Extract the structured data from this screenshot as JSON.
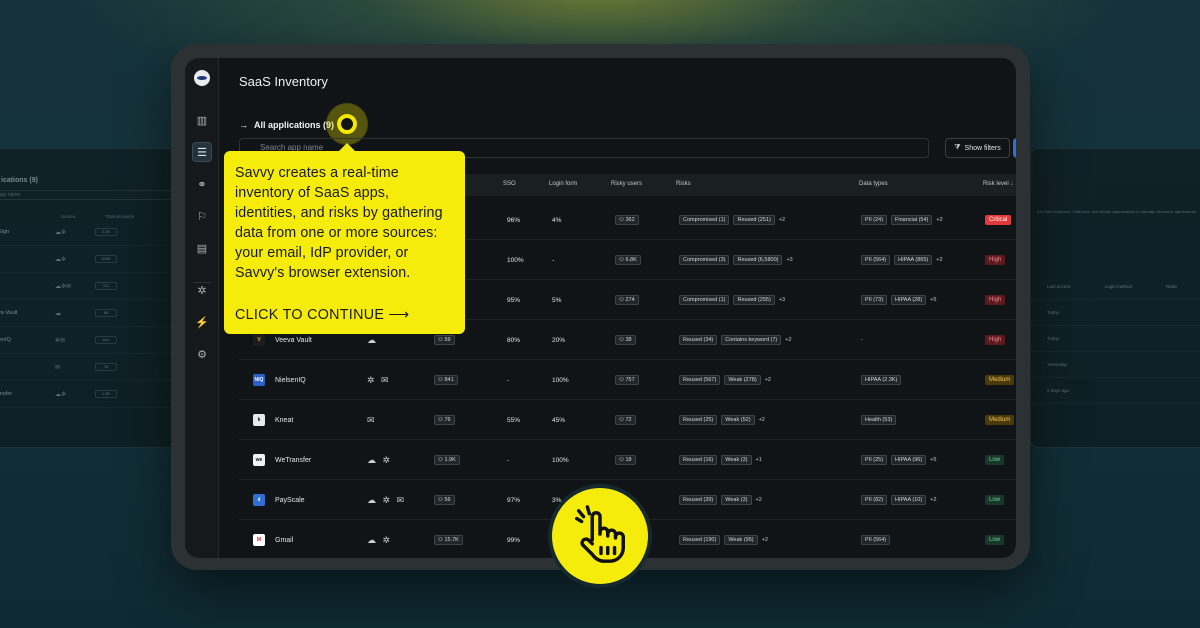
{
  "page": {
    "title": "SaaS Inventory",
    "all_apps": "All applications (9)",
    "search_placeholder": "Search app name",
    "show_filters": "Show filters"
  },
  "columns": [
    "Source",
    "Total accounts",
    "SSO",
    "Login form",
    "Risky users",
    "Risks",
    "Data types",
    "Risk level"
  ],
  "rows": [
    {
      "name": "",
      "source": "",
      "accounts": "",
      "sso": "96%",
      "login": "4%",
      "risky": "362",
      "risks": [
        "Compromised (1)",
        "Reused (251)"
      ],
      "risks_more": "+2",
      "data": [
        "PII (24)",
        "Financial (54)"
      ],
      "data_more": "+2",
      "level": "Critical",
      "level_class": "crit"
    },
    {
      "name": "",
      "source": "",
      "accounts": "",
      "sso": "100%",
      "login": "-",
      "risky": "6.8K",
      "risks": [
        "Compromised (3)",
        "Reused (6,5800)"
      ],
      "risks_more": "+3",
      "data": [
        "PII (564)",
        "HIPAA (865)"
      ],
      "data_more": "+2",
      "level": "High",
      "level_class": "high"
    },
    {
      "name": "",
      "source": "",
      "accounts": "",
      "sso": "95%",
      "login": "5%",
      "risky": "274",
      "risks": [
        "Compromised (1)",
        "Reused (255)"
      ],
      "risks_more": "+3",
      "data": [
        "PII (73)",
        "HIPAA (28)"
      ],
      "data_more": "+5",
      "level": "High",
      "level_class": "high"
    },
    {
      "name": "Veeva Vault",
      "source": "☁",
      "accounts": "59",
      "sso": "80%",
      "login": "20%",
      "risky": "38",
      "risks": [
        "Reused (34)",
        "Contains keyword (7)"
      ],
      "risks_more": "+2",
      "data": [],
      "data_more": "-",
      "level": "High",
      "level_class": "high",
      "logo_bg": "#1c1c1c",
      "logo_fg": "#e6a93a",
      "logo_txt": "V"
    },
    {
      "name": "NielsenIQ",
      "source": "✲ ✉",
      "accounts": "841",
      "sso": "-",
      "login": "100%",
      "risky": "757",
      "risks": [
        "Reused (567)",
        "Weak (278)"
      ],
      "risks_more": "+2",
      "data": [
        "HIPAA (2.3K)"
      ],
      "data_more": "",
      "level": "Medium",
      "level_class": "med",
      "logo_bg": "#2a61c9",
      "logo_fg": "#ffffff",
      "logo_txt": "NIQ"
    },
    {
      "name": "Kneat",
      "source": "✉",
      "accounts": "76",
      "sso": "55%",
      "login": "45%",
      "risky": "72",
      "risks": [
        "Reused (25)",
        "Weak (52)"
      ],
      "risks_more": "+2",
      "data": [
        "Health (53)"
      ],
      "data_more": "",
      "level": "Medium",
      "level_class": "med",
      "logo_bg": "#e9e9e9",
      "logo_fg": "#111",
      "logo_txt": "k"
    },
    {
      "name": "WeTransfer",
      "source": "☁ ✲",
      "accounts": "1.9K",
      "sso": "-",
      "login": "100%",
      "risky": "18",
      "risks": [
        "Reused (16)",
        "Weak (3)"
      ],
      "risks_more": "+1",
      "data": [
        "PII (25)",
        "HIPAA (96)"
      ],
      "data_more": "+5",
      "level": "Low",
      "level_class": "low",
      "logo_bg": "#f2f2f2",
      "logo_fg": "#111",
      "logo_txt": "we"
    },
    {
      "name": "PayScale",
      "source": "☁ ✲ ✉",
      "accounts": "56",
      "sso": "97%",
      "login": "3%",
      "risky": "",
      "risks": [
        "Reused (39)",
        "Weak (3)"
      ],
      "risks_more": "+2",
      "data": [
        "PII (82)",
        "HIPAA (10)"
      ],
      "data_more": "+2",
      "level": "Low",
      "level_class": "low",
      "logo_bg": "#2f6fd1",
      "logo_fg": "#fff",
      "logo_txt": "ıl"
    },
    {
      "name": "Gmail",
      "source": "☁ ✲",
      "accounts": "15.7K",
      "sso": "99%",
      "login": "",
      "risky": "",
      "risks": [
        "Reused (190)",
        "Weak (95)"
      ],
      "risks_more": "+2",
      "data": [
        "PII (564)"
      ],
      "data_more": "",
      "level": "Low",
      "level_class": "low",
      "logo_bg": "#ffffff",
      "logo_fg": "#d93025",
      "logo_txt": "M"
    }
  ],
  "tooltip": {
    "text": "Savvy creates a real-time inventory of SaaS apps, identities, and risks by gathering data from one or more sources: your email, IdP provider, or Savvy's browser extension.",
    "cta": "CLICK TO CONTINUE ⟶"
  },
  "bg_left": {
    "title": "ications (9)",
    "search": "app name",
    "headers": [
      "Source",
      "Total accounts"
    ],
    "rows": [
      {
        "name": "uSign",
        "icons": "☁✲",
        "count": "2.3K"
      },
      {
        "name": "d",
        "icons": "☁✲",
        "count": "106K"
      },
      {
        "name": "b",
        "icons": "☁✲✉",
        "count": "311"
      },
      {
        "name": "eva Vault",
        "icons": "☁",
        "count": "86"
      },
      {
        "name": "lsenIQ",
        "icons": "✲✉",
        "count": "841"
      },
      {
        "name": "t",
        "icons": "✉",
        "count": "76"
      },
      {
        "name": "ransfer",
        "icons": "☁✲",
        "count": "1.9K"
      }
    ]
  },
  "bg_right": {
    "desc": "d in San Francisco, California, that allows organizations to manage electronic agreements",
    "headers": [
      "Last access",
      "Login method",
      "Risks"
    ],
    "rows": [
      "Today",
      "Today",
      "Yesterday",
      "2 days ago"
    ]
  },
  "colors": {
    "accent_yellow": "#f6ec0c",
    "primary_blue": "#2b6fd8"
  }
}
